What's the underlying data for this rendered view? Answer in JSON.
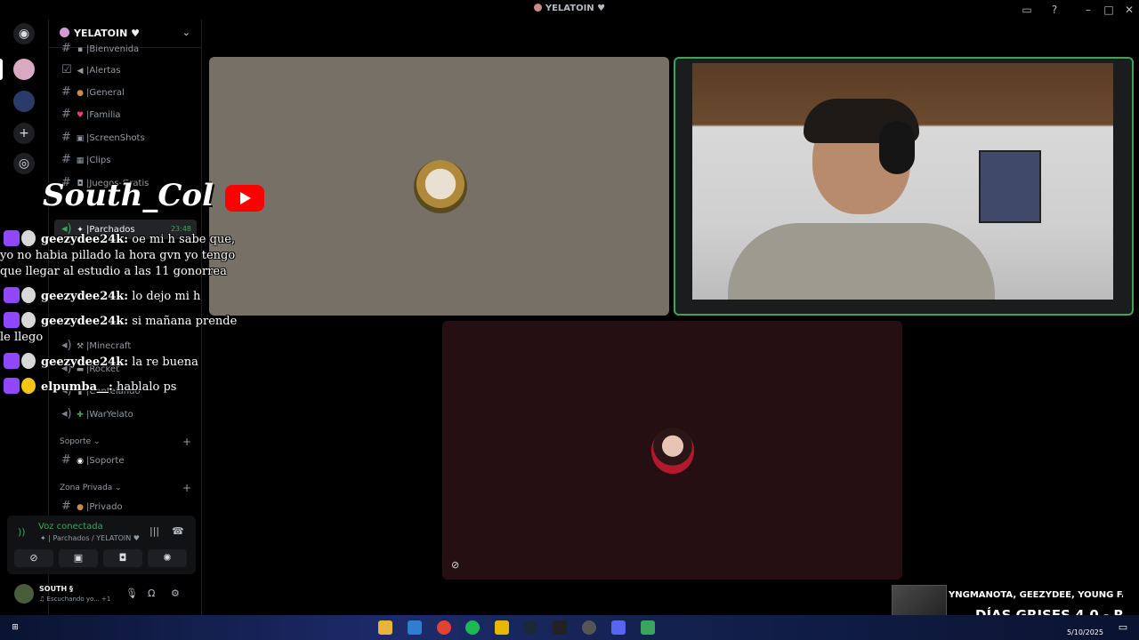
{
  "window": {
    "title": "YELATOIN"
  },
  "colors": {
    "accent_green": "#3ba55d",
    "twitch_purple": "#9146ff",
    "youtube_red": "#ff0000"
  },
  "server": {
    "name": "YELATOIN"
  },
  "channels": [
    {
      "label": "Bienvenida",
      "icon": "door-icon"
    },
    {
      "label": "Alertas",
      "icon": "megaphone-icon"
    },
    {
      "label": "General",
      "icon": "monkey-icon"
    },
    {
      "label": "Familia",
      "icon": "heart-icon"
    },
    {
      "label": "ScreenShots",
      "icon": "camera-icon"
    },
    {
      "label": "Clips",
      "icon": "clips-icon"
    },
    {
      "label": "Juegos-Gratis",
      "icon": "gamepad-icon"
    }
  ],
  "voice_channels": {
    "active": {
      "label": "Parchados",
      "time": "23:48"
    },
    "others": [
      {
        "label": "Minecraft"
      },
      {
        "label": "Rocket"
      },
      {
        "label": "Cantelando"
      },
      {
        "label": "WarYelato"
      }
    ]
  },
  "categories": {
    "support": {
      "label": "Soporte",
      "channel": "Soporte"
    },
    "private": {
      "label": "Zona Privada",
      "channel": "Privado"
    }
  },
  "voice_panel": {
    "status": "Voz conectada",
    "channel": "| Parchados / YELATOIN"
  },
  "user": {
    "name": "SOUTH",
    "status": "Escuchando yo...",
    "extra": "+1"
  },
  "overlay": {
    "streamer": "South_Col",
    "chat": [
      {
        "user": "geezydee24k:",
        "text": "oe mi h sabe que, yo no habia pillado la hora gvn yo tengo que llegar al estudio a las 11 gonorrea"
      },
      {
        "user": "geezydee24k:",
        "text": "lo dejo mi h"
      },
      {
        "user": "geezydee24k:",
        "text": "si mañana prende le llego"
      },
      {
        "user": "geezydee24k:",
        "text": "la re buena"
      },
      {
        "user": "elpumba__:",
        "text": "hablalo ps"
      }
    ]
  },
  "now_playing": {
    "artists": "YNGMANOTA, GEEZYDEE, YOUNG FAT",
    "title": "DÍAS GRISES 4.0 - R"
  },
  "taskbar": {
    "date": "5/10/2025"
  }
}
